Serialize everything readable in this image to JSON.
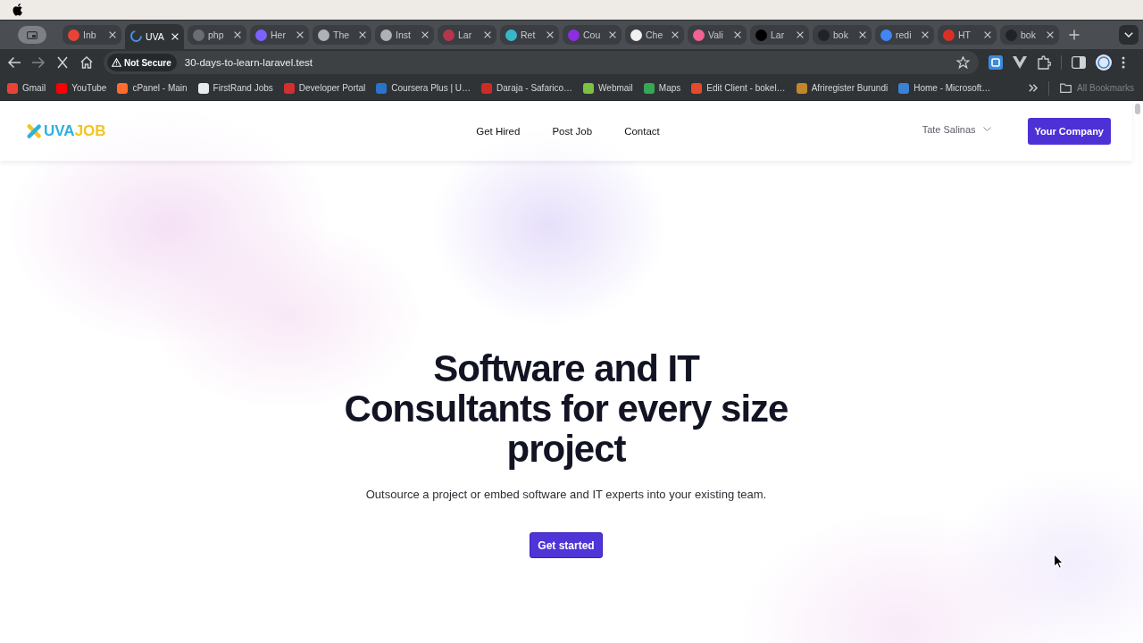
{
  "browser": {
    "loading": true,
    "tabs": [
      {
        "title": "Inb",
        "selected": false,
        "color": "#ea4335"
      },
      {
        "title": "UVA",
        "selected": true,
        "color": "#4a8fe7"
      },
      {
        "title": "php",
        "selected": false,
        "color": "#6b6f73"
      },
      {
        "title": "Her",
        "selected": false,
        "color": "#7b61ff"
      },
      {
        "title": "The",
        "selected": false,
        "color": "#aeb1b5"
      },
      {
        "title": "Inst",
        "selected": false,
        "color": "#aeb1b5"
      },
      {
        "title": "Lar",
        "selected": false,
        "color": "#b5364b"
      },
      {
        "title": "Ret",
        "selected": false,
        "color": "#3ab6c9"
      },
      {
        "title": "Cou",
        "selected": false,
        "color": "#8e2de2"
      },
      {
        "title": "Che",
        "selected": false,
        "color": "#f1f1f1"
      },
      {
        "title": "Vali",
        "selected": false,
        "color": "#f06292"
      },
      {
        "title": "Lar",
        "selected": false,
        "color": "#000000"
      },
      {
        "title": "bok",
        "selected": false,
        "color": "#202428"
      },
      {
        "title": "redi",
        "selected": false,
        "color": "#4285f4"
      },
      {
        "title": "HT",
        "selected": false,
        "color": "#d93025"
      },
      {
        "title": "bok",
        "selected": false,
        "color": "#202428"
      }
    ],
    "address_bar": {
      "security_label": "Not Secure",
      "url": "30-days-to-learn-laravel.test"
    },
    "bookmarks": [
      {
        "label": "Gmail",
        "color": "#ea4335"
      },
      {
        "label": "YouTube",
        "color": "#ff0000"
      },
      {
        "label": "cPanel - Main",
        "color": "#ff6c2c"
      },
      {
        "label": "FirstRand Jobs",
        "color": "#e8eaed"
      },
      {
        "label": "Developer Portal",
        "color": "#d32f2f"
      },
      {
        "label": "Coursera Plus | U…",
        "color": "#2a73cc"
      },
      {
        "label": "Daraja - Safarico…",
        "color": "#cf2a27"
      },
      {
        "label": "Webmail",
        "color": "#7cc242"
      },
      {
        "label": "Maps",
        "color": "#34a853"
      },
      {
        "label": "Edit Client - bokel…",
        "color": "#e64a2e"
      },
      {
        "label": "Afriregister Burundi",
        "color": "#c4862b"
      },
      {
        "label": "Home - Microsoft…",
        "color": "#3b82d6"
      }
    ],
    "all_bookmarks": "All Bookmarks"
  },
  "page": {
    "logo": [
      {
        "text": "UVA",
        "color": "#2fb0e3"
      },
      {
        "text": "JOB",
        "color": "#f2c61f"
      }
    ],
    "nav": [
      "Get Hired",
      "Post Job",
      "Contact"
    ],
    "user_menu": "Tate Salinas",
    "company_button": "Your Company",
    "hero": {
      "title": "Software and IT Consultants for every size project",
      "subtitle": "Outsource a project or embed software and IT experts into your existing team.",
      "button": "Get started"
    }
  }
}
